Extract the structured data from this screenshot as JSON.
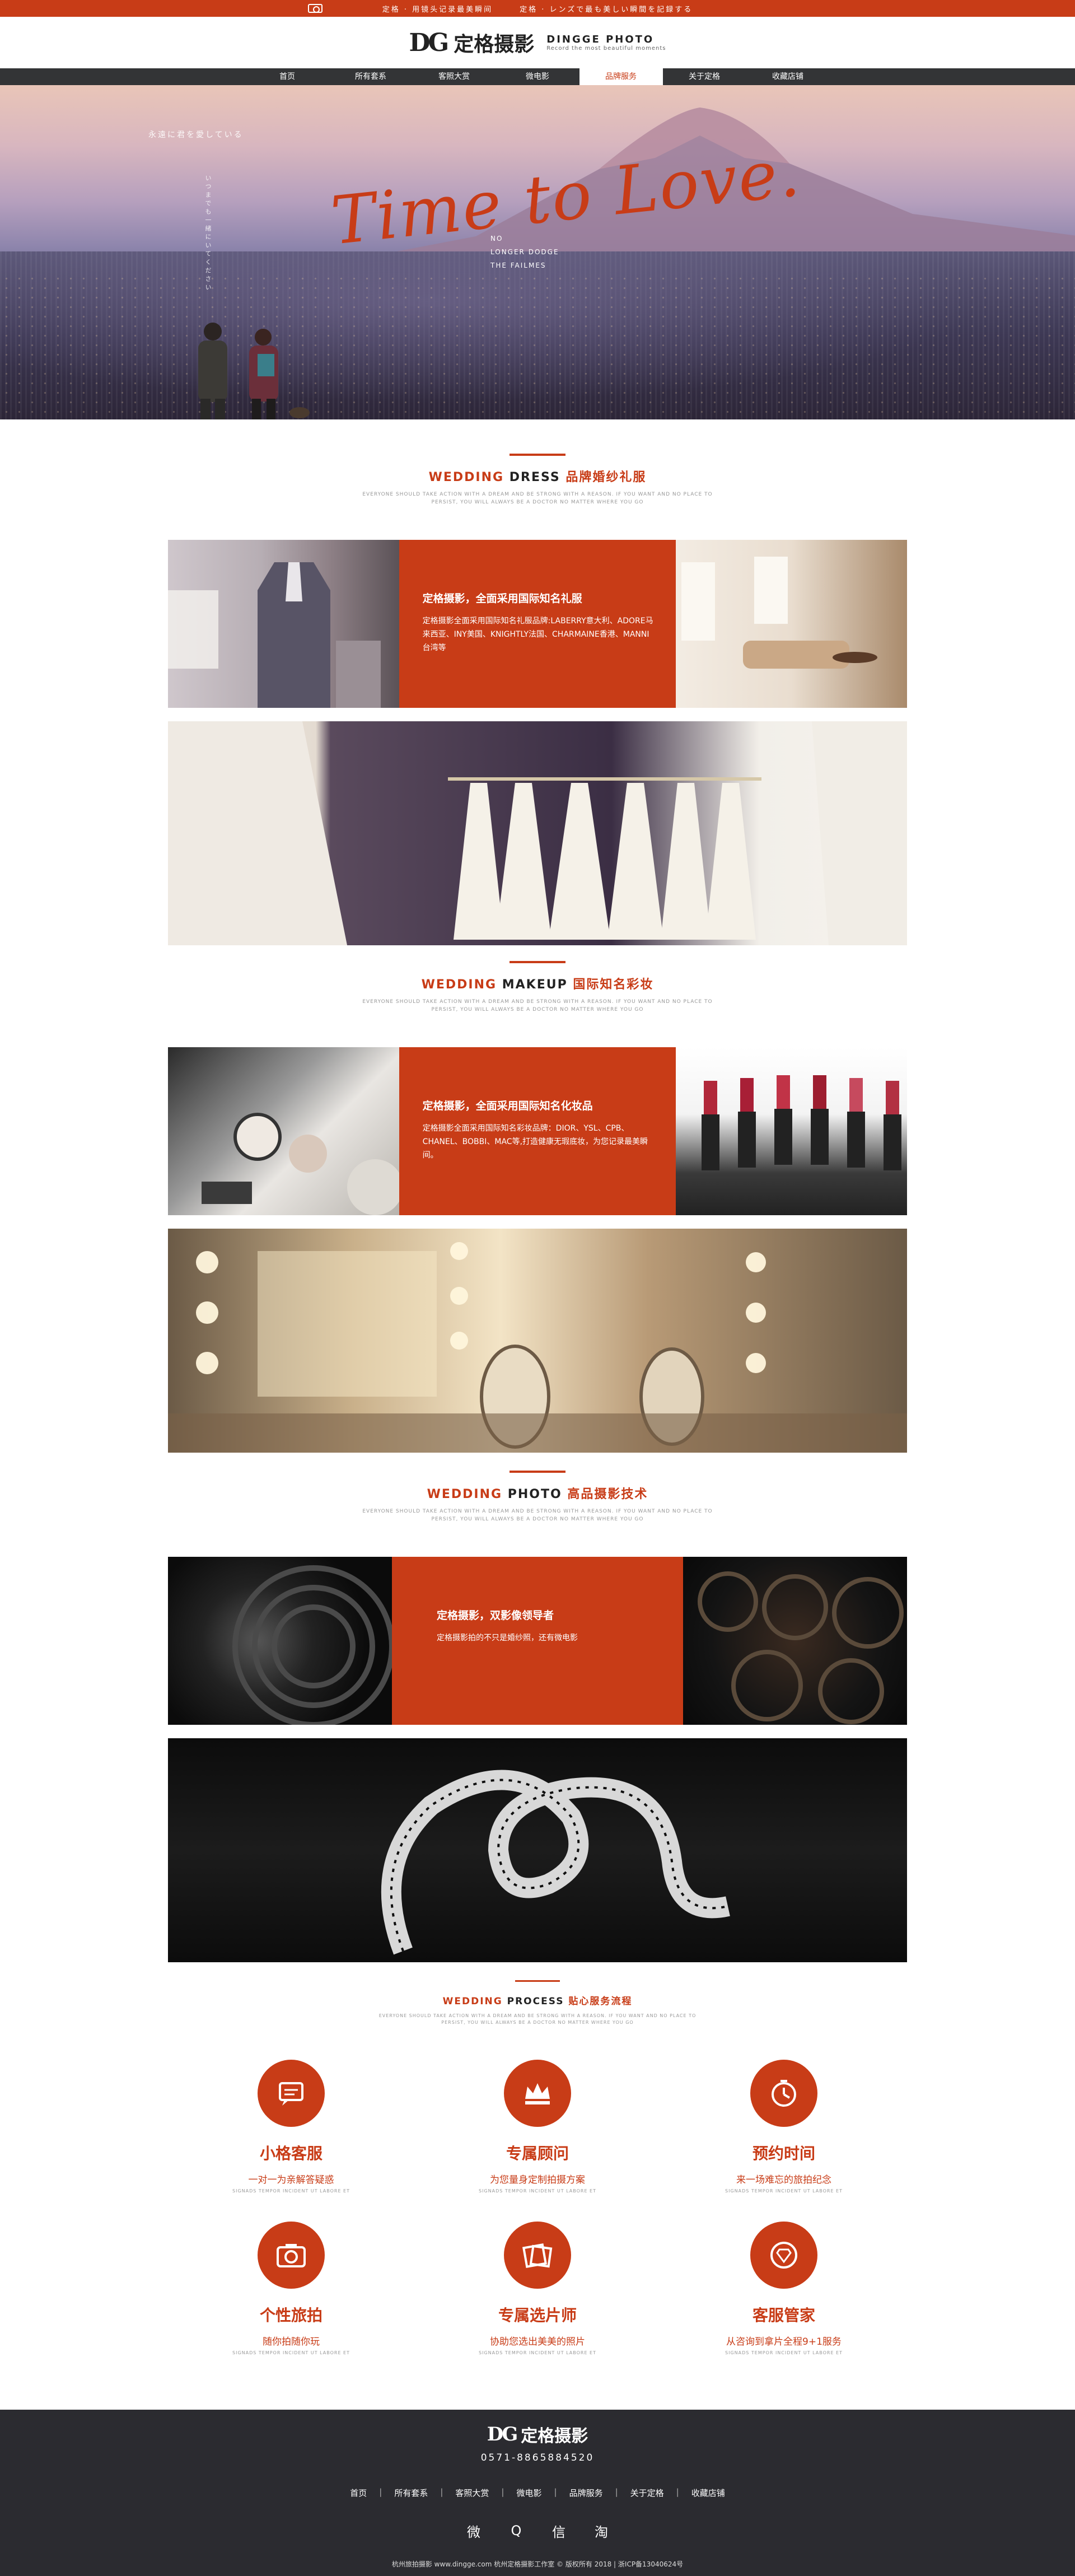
{
  "topbar": {
    "left": "定格 · 用镜头记录最美瞬间",
    "right": "定格 · レンズで最も美しい瞬間を記録する"
  },
  "brand": {
    "mark": "DG",
    "name": "定格摄影",
    "en": "DINGGE PHOTO",
    "slogan": "Record the most beautiful moments"
  },
  "nav": [
    {
      "label": "首页"
    },
    {
      "label": "所有套系"
    },
    {
      "label": "客照大赏"
    },
    {
      "label": "微电影"
    },
    {
      "label": "品牌服务"
    },
    {
      "label": "关于定格"
    },
    {
      "label": "收藏店铺"
    }
  ],
  "hero": {
    "script": "Time to Love.",
    "jp": "永遠に君を愛している",
    "vert": "いつまでも一緒にいてください",
    "no_longer_1": "NO",
    "no_longer_2": "LONGER DODGE",
    "no_longer_3": "THE FAILMES"
  },
  "sections": [
    {
      "w": "WEDDING",
      "m": "DRESS",
      "cn": "品牌婚纱礼服",
      "sub1": "EVERYONE SHOULD TAKE ACTION WITH A DREAM AND BE STRONG WITH A REASON. IF YOU WANT AND NO PLACE TO",
      "sub2": "PERSIST, YOU WILL ALWAYS BE A DOCTOR NO MATTER WHERE YOU GO",
      "mid_title": "定格摄影，全面采用国际知名礼服",
      "mid_text": "定格摄影全面采用国际知名礼服品牌:LABERRY意大利、ADORE马来西亚、INY美国、KNIGHTLY法国、CHARMAINE香港、MANNI台湾等"
    },
    {
      "w": "WEDDING",
      "m": "MAKEUP",
      "cn": "国际知名彩妆",
      "sub1": "EVERYONE SHOULD TAKE ACTION WITH A DREAM AND BE STRONG WITH A REASON. IF YOU WANT AND NO PLACE TO",
      "sub2": "PERSIST, YOU WILL ALWAYS BE A DOCTOR NO MATTER WHERE YOU GO",
      "mid_title": "定格摄影，全面采用国际知名化妆品",
      "mid_text": "定格摄影全面采用国际知名彩妆品牌：DIOR、YSL、CPB、CHANEL、BOBBI、MAC等,打造健康无瑕底妆，为您记录最美瞬间。"
    },
    {
      "w": "WEDDING",
      "m": "PHOTO",
      "cn": "高品摄影技术",
      "sub1": "EVERYONE SHOULD TAKE ACTION WITH A DREAM AND BE STRONG WITH A REASON. IF YOU WANT AND NO PLACE TO",
      "sub2": "PERSIST, YOU WILL ALWAYS BE A DOCTOR NO MATTER WHERE YOU GO",
      "mid_title": "定格摄影，双影像领导者",
      "mid_text": "定格摄影拍的不只是婚纱照，还有微电影"
    }
  ],
  "process": {
    "w": "WEDDING",
    "m": "PROCESS",
    "cn": "贴心服务流程",
    "sub1": "EVERYONE SHOULD TAKE ACTION WITH A DREAM AND BE STRONG WITH A REASON. IF YOU WANT AND NO PLACE TO",
    "sub2": "PERSIST, YOU WILL ALWAYS BE A DOCTOR NO MATTER WHERE YOU GO",
    "items": [
      {
        "title": "小格客服",
        "desc": "一对一为亲解答疑惑",
        "tiny": "SIGNADS TEMPOR INCIDENT UT LABORE ET",
        "icon": "chat-icon"
      },
      {
        "title": "专属顾问",
        "desc": "为您量身定制拍摄方案",
        "tiny": "SIGNADS TEMPOR INCIDENT UT LABORE ET",
        "icon": "crown-icon"
      },
      {
        "title": "预约时间",
        "desc": "来一场难忘的旅拍纪念",
        "tiny": "SIGNADS TEMPOR INCIDENT UT LABORE ET",
        "icon": "clock-icon"
      },
      {
        "title": "个性旅拍",
        "desc": "随你拍随你玩",
        "tiny": "SIGNADS TEMPOR INCIDENT UT LABORE ET",
        "icon": "camera-icon"
      },
      {
        "title": "专属选片师",
        "desc": "协助您选出美美的照片",
        "tiny": "SIGNADS TEMPOR INCIDENT UT LABORE ET",
        "icon": "photos-icon"
      },
      {
        "title": "客服管家",
        "desc": "从咨询到拿片全程9+1服务",
        "tiny": "SIGNADS TEMPOR INCIDENT UT LABORE ET",
        "icon": "diamond-icon"
      }
    ]
  },
  "footer": {
    "mark": "DG",
    "name": "定格摄影",
    "phone": "0571-8865884520",
    "nav": [
      "首页",
      "所有套系",
      "客照大赏",
      "微电影",
      "品牌服务",
      "关于定格",
      "收藏店铺"
    ],
    "copyright": "杭州旅拍摄影 www.dingge.com 杭州定格摄影工作室 © 版权所有 2018 | 浙ICP备13040624号",
    "social": [
      "weibo-icon",
      "qq-icon",
      "wechat-icon",
      "taobao-icon"
    ],
    "social_glyphs": [
      "微",
      "Q",
      "信",
      "淘"
    ]
  },
  "colors": {
    "accent": "#c83c17",
    "dark": "#333436",
    "footer": "#2b2b30"
  }
}
